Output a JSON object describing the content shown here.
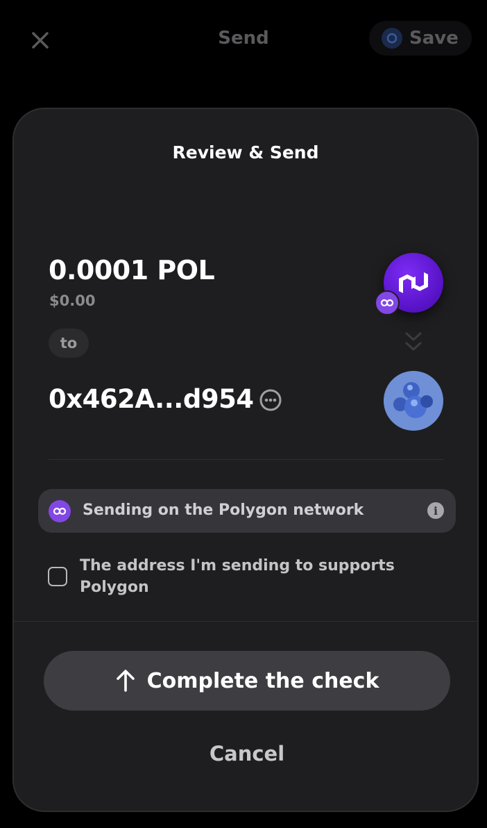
{
  "background": {
    "title": "Send",
    "save_label": "Save"
  },
  "review": {
    "title": "Review & Send",
    "amount": "0.0001 POL",
    "fiat_value": "$0.00",
    "to_label": "to",
    "recipient_address": "0x462A...d954",
    "network_notice": "Sending on the Polygon network",
    "confirm_checkbox_label": "The address I'm sending to supports Polygon",
    "confirm_checked": false,
    "primary_button_label": "Complete the check",
    "cancel_label": "Cancel"
  },
  "icons": {
    "close": "close-icon",
    "token": "polygon-token-icon",
    "chain_badge": "polygon-chain-badge-icon",
    "direction": "double-chevron-down-icon",
    "more": "more-options-icon",
    "info": "info-icon",
    "arrow_up": "arrow-up-icon"
  },
  "colors": {
    "sheet_background": "#1e1e20",
    "polygon_purple": "#8247e5",
    "primary_button": "#3d3d42",
    "network_bar": "#35353a"
  }
}
